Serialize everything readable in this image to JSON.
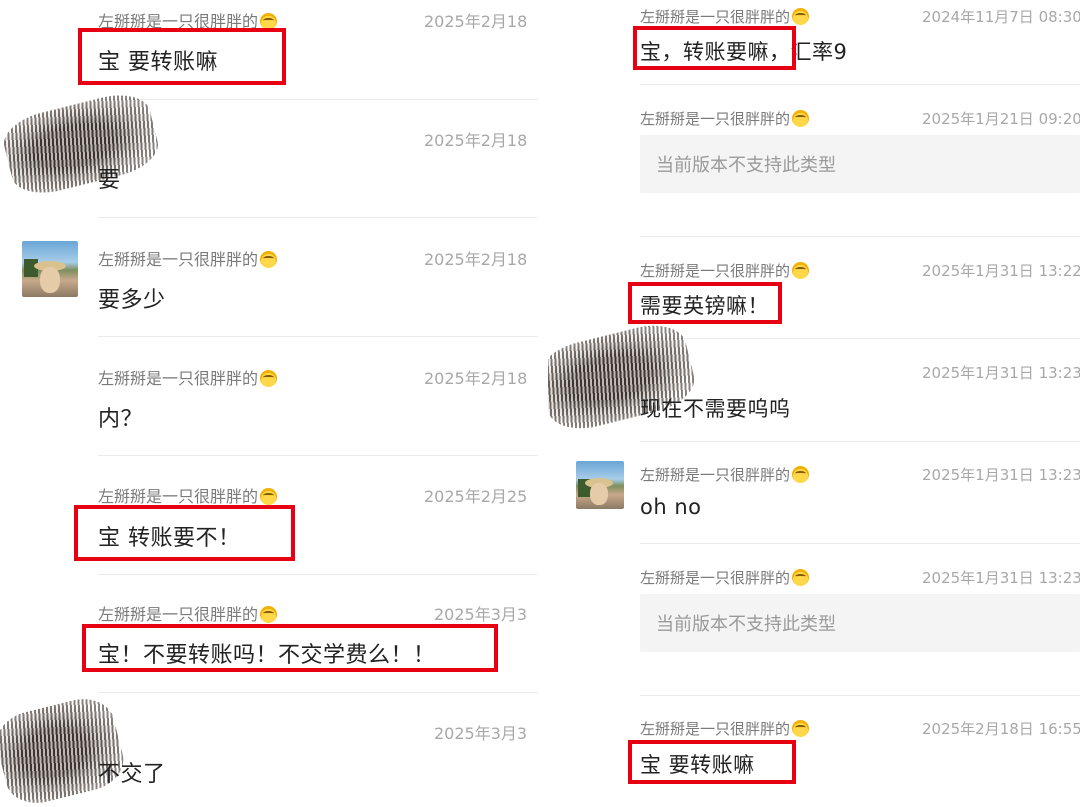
{
  "sender_name": "左掰掰是一只很胖胖的",
  "left_panel": {
    "messages": [
      {
        "time": "2025年2月18",
        "text": "宝 要转账嘛",
        "highlighted": true
      },
      {
        "time": "2025年2月18",
        "text": "要",
        "highlighted": false
      },
      {
        "time": "2025年2月18",
        "text": "要多少",
        "highlighted": false
      },
      {
        "time": "2025年2月18",
        "text": "内？",
        "highlighted": false
      },
      {
        "time": "2025年2月25",
        "text": "宝 转账要不！",
        "highlighted": true
      },
      {
        "time": "2025年3月3",
        "text": "宝！不要转账吗！不交学费么！！",
        "highlighted": true
      },
      {
        "time": "2025年3月3",
        "text": "不交了",
        "highlighted": false
      }
    ]
  },
  "right_panel": {
    "messages": [
      {
        "time": "2024年11月7日 08:30",
        "text": "宝，转账要嘛，汇率9",
        "highlighted": true
      },
      {
        "time": "2025年1月21日 09:20",
        "text": "当前版本不支持此类型",
        "unsupported": true
      },
      {
        "time": "2025年1月31日 13:22",
        "text": "需要英镑嘛！",
        "highlighted": true
      },
      {
        "time": "2025年1月31日 13:23",
        "text": "现在不需要呜呜",
        "highlighted": false
      },
      {
        "time": "2025年1月31日 13:23",
        "text": "oh no",
        "highlighted": false
      },
      {
        "time": "2025年1月31日 13:23",
        "text": "当前版本不支持此类型",
        "unsupported": true
      },
      {
        "time": "2025年2月18日 16:55",
        "text": "宝 要转账嘛",
        "highlighted": true
      }
    ]
  },
  "colors": {
    "highlight": "#e60012",
    "text": "#222222",
    "sender": "#7a7a7a",
    "time": "#a8a8a8",
    "unsupported_bg": "#f4f4f4"
  },
  "icons": [
    "chick-emoji-icon",
    "avatar-image",
    "redacted-avatar-blur"
  ]
}
